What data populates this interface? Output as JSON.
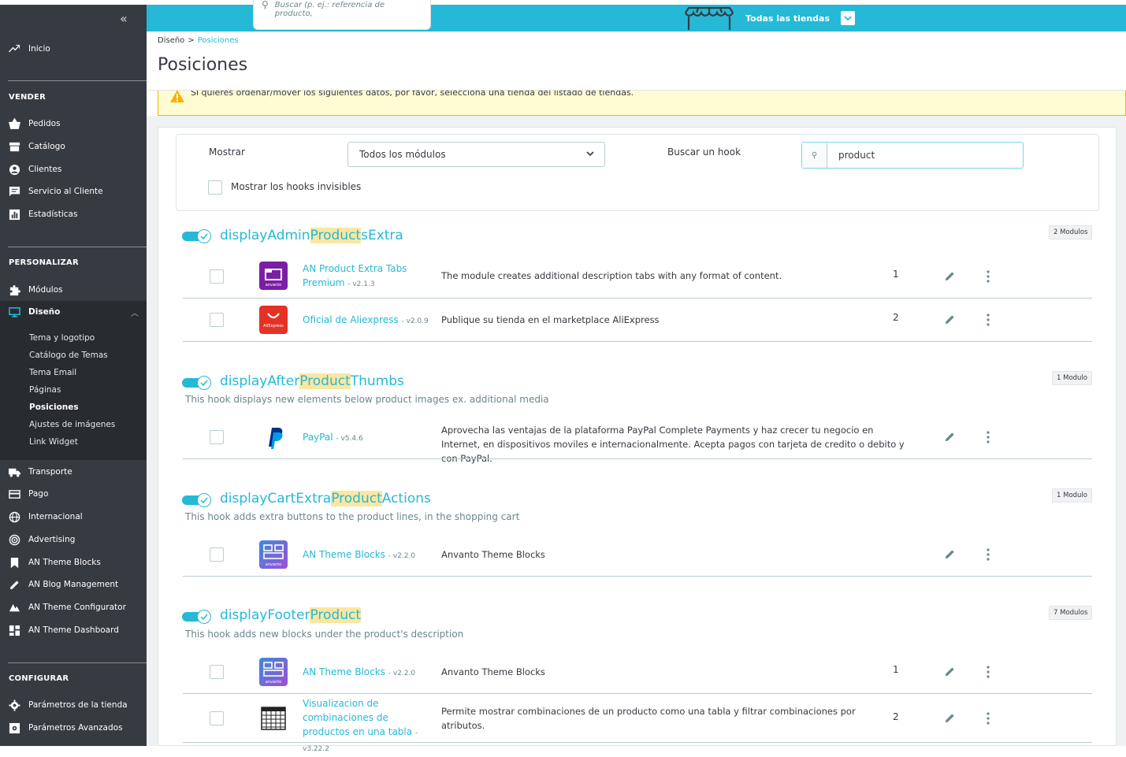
{
  "sidebar": {
    "collapse": "«",
    "inicio": "Inicio",
    "sections": {
      "vender": "VENDER",
      "personalizar": "PERSONALIZAR",
      "configurar": "CONFIGURAR"
    },
    "vender_items": [
      "Pedidos",
      "Catálogo",
      "Clientes",
      "Servicio al Cliente",
      "Estadísticas"
    ],
    "personalizar_items": {
      "modulos": "Módulos",
      "diseno": "Diseño"
    },
    "diseno_sub": [
      "Tema y logotipo",
      "Catálogo de Temas",
      "Tema Email",
      "Páginas",
      "Posiciones",
      "Ajustes de imágenes",
      "Link Widget"
    ],
    "more_items": [
      "Transporte",
      "Pago",
      "Internacional",
      "Advertising",
      "AN Theme Blocks",
      "AN Blog Management",
      "AN Theme Configurator",
      "AN Theme Dashboard"
    ],
    "configurar_items": [
      "Parámetros de la tienda",
      "Parámetros Avanzados"
    ]
  },
  "header": {
    "search_placeholder": "Buscar (p. ej.: referencia de producto,",
    "store_label": "Todas las tiendas"
  },
  "breadcrumb": {
    "parent": "Diseño",
    "sep": ">",
    "current": "Posiciones"
  },
  "page_title": "Posiciones",
  "alert": "Si quieres ordenar/mover los siguientes datos, por favor, selecciona una tienda del listado de tiendas.",
  "filter": {
    "show_label": "Mostrar",
    "show_value": "Todos los módulos",
    "search_label": "Buscar un hook",
    "search_value": "product",
    "invisible_label": "Mostrar los hooks invisibles"
  },
  "hooks": [
    {
      "pre": "displayAdmin",
      "hl": "Product",
      "post": "sExtra",
      "desc": "",
      "badge": "2 Modulos",
      "modules": [
        {
          "name": "AN Product Extra Tabs Premium",
          "version": "- v2.1.3",
          "desc": "The module creates additional description tabs with any format of content.",
          "pos": "1"
        },
        {
          "name": "Oficial de Aliexpress",
          "version": "- v2.0.9",
          "desc": "Publique su tienda en el marketplace AliExpress",
          "pos": "2"
        }
      ]
    },
    {
      "pre": "displayAfter",
      "hl": "Product",
      "post": "Thumbs",
      "desc": "This hook displays new elements below product images ex. additional media",
      "badge": "1 Modulo",
      "modules": [
        {
          "name": "PayPal",
          "version": "- v5.4.6",
          "desc": "Aprovecha las ventajas de la plataforma PayPal Complete Payments y haz crecer tu negocio en Internet, en dispositivos moviles e internacionalmente. Acepta pagos con tarjeta de credito o debito y con PayPal.",
          "pos": ""
        }
      ]
    },
    {
      "pre": "displayCartExtra",
      "hl": "Product",
      "post": "Actions",
      "desc": "This hook adds extra buttons to the product lines, in the shopping cart",
      "badge": "1 Modulo",
      "modules": [
        {
          "name": "AN Theme Blocks",
          "version": "- v2.2.0",
          "desc": "Anvanto Theme Blocks",
          "pos": ""
        }
      ]
    },
    {
      "pre": "displayFooter",
      "hl": "Product",
      "post": "",
      "desc": "This hook adds new blocks under the product's description",
      "badge": "7 Modulos",
      "modules": [
        {
          "name": "AN Theme Blocks",
          "version": "- v2.2.0",
          "desc": "Anvanto Theme Blocks",
          "pos": "1"
        },
        {
          "name": "Visualizacion de combinaciones de productos en una tabla",
          "version": "- v3.22.2",
          "desc": "Permite mostrar combinaciones de un producto como una tabla y filtrar combinaciones por atributos.",
          "pos": "2"
        }
      ]
    }
  ],
  "logo_text": {
    "anvanto": "anvanto",
    "aliexpress": "AliExpress"
  },
  "colors": {
    "primary": "#25b9d7",
    "sidebar": "#363a41",
    "highlight": "#fbe7a2",
    "alert_bg": "#fffbd3"
  }
}
